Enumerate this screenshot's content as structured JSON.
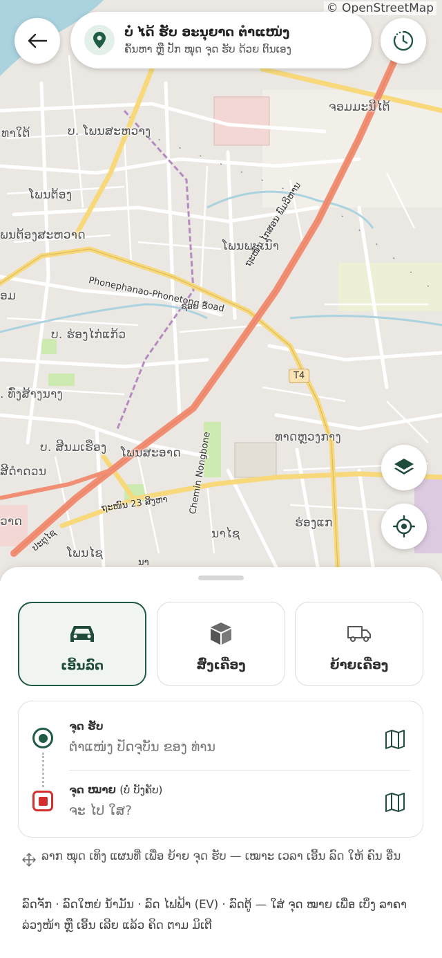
{
  "map": {
    "attribution": "© OpenStreetMap",
    "labels": {
      "jomphet": "ຈອມມະນີໄຕ້",
      "phonsaat": "ບ. ໂພນສະຫວາງ",
      "thitai": "ທາໃຕ້",
      "phontong": "ໂພນຕ້ອງ",
      "phontong_sawat": "ພນຕ້ອງສະຫວາດ",
      "phonphamao": "ໂພນພະເນົາ",
      "om": "ອມ",
      "nongthao": "ບ. ຮ່ອງໄກ່ແກ້ວ",
      "thangsang": ". ທົ່ງສ້າງນາງ",
      "sinsai": "ບ. ສີນມເຮືອງ",
      "phonsaad": "ໂພນສະອາດ",
      "sidam": "ສີດຳດວນ",
      "thatluang": "ທາດຫຼວງກາງ",
      "vat": "ວາດ",
      "phonxai": "ໂພນໄຊ",
      "naxai": "ນາໄຊ",
      "honghae": "ຮ່ອງແກ",
      "patuxai": "ປະຕູໄຊ",
      "nam": "ນາ"
    },
    "roads": {
      "phonephanao": "Phonephanao-Phonetong Road",
      "kamphaeng": "ຖະໜົນ ໄກສອນ ພົມວິຫານ",
      "soi3": "ຊອຍ 3",
      "chemin": "Chemin Nongbone",
      "road23": "ຖະໜົນ 23 ສິງຫາ",
      "t4": "T4"
    }
  },
  "header": {
    "pickup_title": "ບໍ່ ໄດ້ ຮັບ ອະນຸຍາດ ຕຳແໜ່ງ",
    "pickup_subtitle": "ຄົ້ນຫາ ຫຼື ປັກ ໝຸດ ຈຸດ ຮັບ ດ້ວຍ ຕົນເອງ"
  },
  "services": [
    {
      "label": "ເອີ້ນລົດ",
      "icon": "car-icon",
      "active": true
    },
    {
      "label": "ສົ່ງເຄື່ອງ",
      "icon": "package-icon",
      "active": false
    },
    {
      "label": "ຍ້າຍເຄື່ອງ",
      "icon": "truck-icon",
      "active": false
    }
  ],
  "route": {
    "pickup_label": "ຈຸດ ຮັບ",
    "pickup_placeholder": "ຕຳແໜ່ງ ປັດຈຸບັນ ຂອງ ທ່ານ",
    "dest_label": "ຈຸດ ໝາຍ",
    "dest_optional": "(ບໍ່ ບັງຄັບ)",
    "dest_placeholder": "ຈະ ໄປ ໃສ?"
  },
  "hint": "ລາກ ໝຸດ ເທິງ ແຜນທີ່ ເພື່ອ ຍ້າຍ ຈຸດ ຮັບ — ເໝາະ ເວລາ ເອີ້ນ ລົດ ໃຫ້ ຄົນ ອື່ນ",
  "note": "ລົດຈັກ · ລົດໃຫຍ່ ນ້ຳມັນ · ລົດ ໄຟຟ້າ (EV) · ລົດຕູ້ — ໃສ່ ຈຸດ ໝາຍ ເພື່ອ ເບິ່ງ ລາຄາ ລ່ວງໜ້າ ຫຼື ເອີ້ນ ເລີຍ ແລ້ວ ຄິດ ຕາມ ມິເຕີ",
  "colors": {
    "brand": "#1f5a43",
    "dest_marker": "#d32f2f",
    "major_road": "#f08f73",
    "secondary_road": "#f7d97c"
  }
}
